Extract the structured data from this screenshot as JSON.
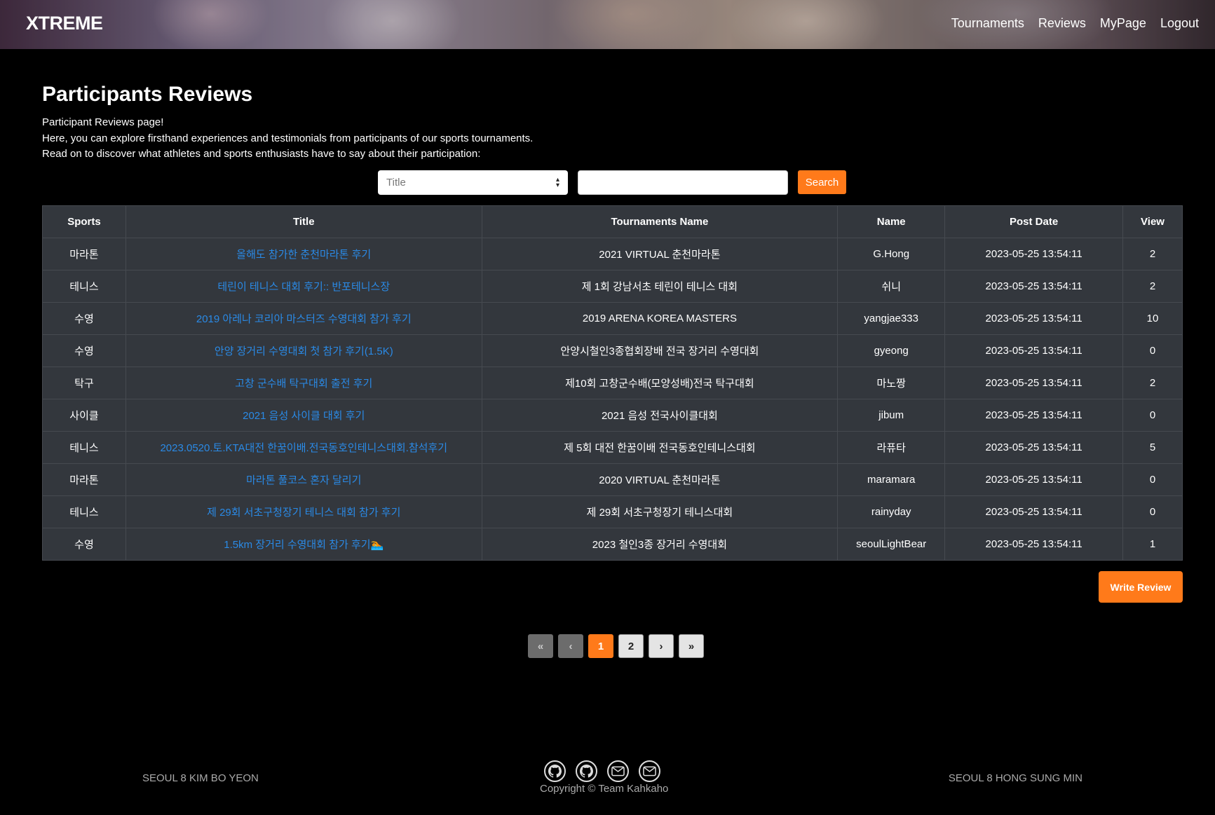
{
  "header": {
    "logo": "XTREME",
    "nav": [
      "Tournaments",
      "Reviews",
      "MyPage",
      "Logout"
    ]
  },
  "main": {
    "title": "Participants Reviews",
    "intro_lines": [
      "Participant Reviews page!",
      "Here, you can explore firsthand experiences and testimonials from participants of our sports tournaments.",
      "Read on to discover what athletes and sports enthusiasts have to say about their participation:"
    ]
  },
  "search": {
    "select_value": "Title",
    "input_value": "",
    "button_label": "Search"
  },
  "table": {
    "headers": [
      "Sports",
      "Title",
      "Tournaments Name",
      "Name",
      "Post Date",
      "View"
    ],
    "rows": [
      {
        "sports": "마라톤",
        "title": "올해도 참가한 춘천마라톤 후기",
        "tournament": "2021 VIRTUAL 춘천마라톤",
        "name": "G.Hong",
        "date": "2023-05-25 13:54:11",
        "view": "2"
      },
      {
        "sports": "테니스",
        "title": "테린이 테니스 대회 후기:: 반포테니스장",
        "tournament": "제 1회 강남서초 테린이 테니스 대회",
        "name": "쉬니",
        "date": "2023-05-25 13:54:11",
        "view": "2"
      },
      {
        "sports": "수영",
        "title": "2019 아레나 코리아 마스터즈 수영대회 참가 후기",
        "tournament": "2019 ARENA KOREA MASTERS",
        "name": "yangjae333",
        "date": "2023-05-25 13:54:11",
        "view": "10"
      },
      {
        "sports": "수영",
        "title": "안양 장거리 수영대회 첫 참가 후기(1.5K)",
        "tournament": "안양시철인3종협회장배 전국 장거리 수영대회",
        "name": "gyeong",
        "date": "2023-05-25 13:54:11",
        "view": "0"
      },
      {
        "sports": "탁구",
        "title": "고창 군수배 탁구대회 출전 후기",
        "tournament": "제10회 고창군수배(모양성배)전국 탁구대회",
        "name": "마노짱",
        "date": "2023-05-25 13:54:11",
        "view": "2"
      },
      {
        "sports": "사이클",
        "title": "2021 음성 사이클 대회 후기",
        "tournament": "2021 음성 전국사이클대회",
        "name": "jibum",
        "date": "2023-05-25 13:54:11",
        "view": "0"
      },
      {
        "sports": "테니스",
        "title": "2023.0520.토.KTA대전 한꿈이배.전국동호인테니스대회.참석후기",
        "tournament": "제 5회 대전 한꿈이배 전국동호인테니스대회",
        "name": "라퓨타",
        "date": "2023-05-25 13:54:11",
        "view": "5"
      },
      {
        "sports": "마라톤",
        "title": "마라톤 풀코스 혼자 달리기",
        "tournament": "2020 VIRTUAL 춘천마라톤",
        "name": "maramara",
        "date": "2023-05-25 13:54:11",
        "view": "0"
      },
      {
        "sports": "테니스",
        "title": "제 29회 서초구청장기 테니스 대회 참가 후기",
        "tournament": "제 29회 서초구청장기 테니스대회",
        "name": "rainyday",
        "date": "2023-05-25 13:54:11",
        "view": "0"
      },
      {
        "sports": "수영",
        "title": "1.5km 장거리 수영대회 참가 후기🏊",
        "tournament": "2023 철인3종 장거리 수영대회",
        "name": "seoulLightBear",
        "date": "2023-05-25 13:54:11",
        "view": "1"
      }
    ]
  },
  "write_review_label": "Write Review",
  "pagination": {
    "first": "«",
    "prev": "‹",
    "pages": [
      "1",
      "2"
    ],
    "current": "1",
    "next": "›",
    "last": "»"
  },
  "footer": {
    "left": "SEOUL 8 KIM BO YEON",
    "right": "SEOUL 8 HONG SUNG MIN",
    "copyright": "Copyright © Team Kahkaho",
    "icons": [
      "github-icon",
      "github-icon",
      "mail-icon",
      "mail-icon"
    ]
  },
  "colors": {
    "accent": "#ff7a1a",
    "link": "#2a8ae6",
    "table_bg": "#33373d"
  }
}
